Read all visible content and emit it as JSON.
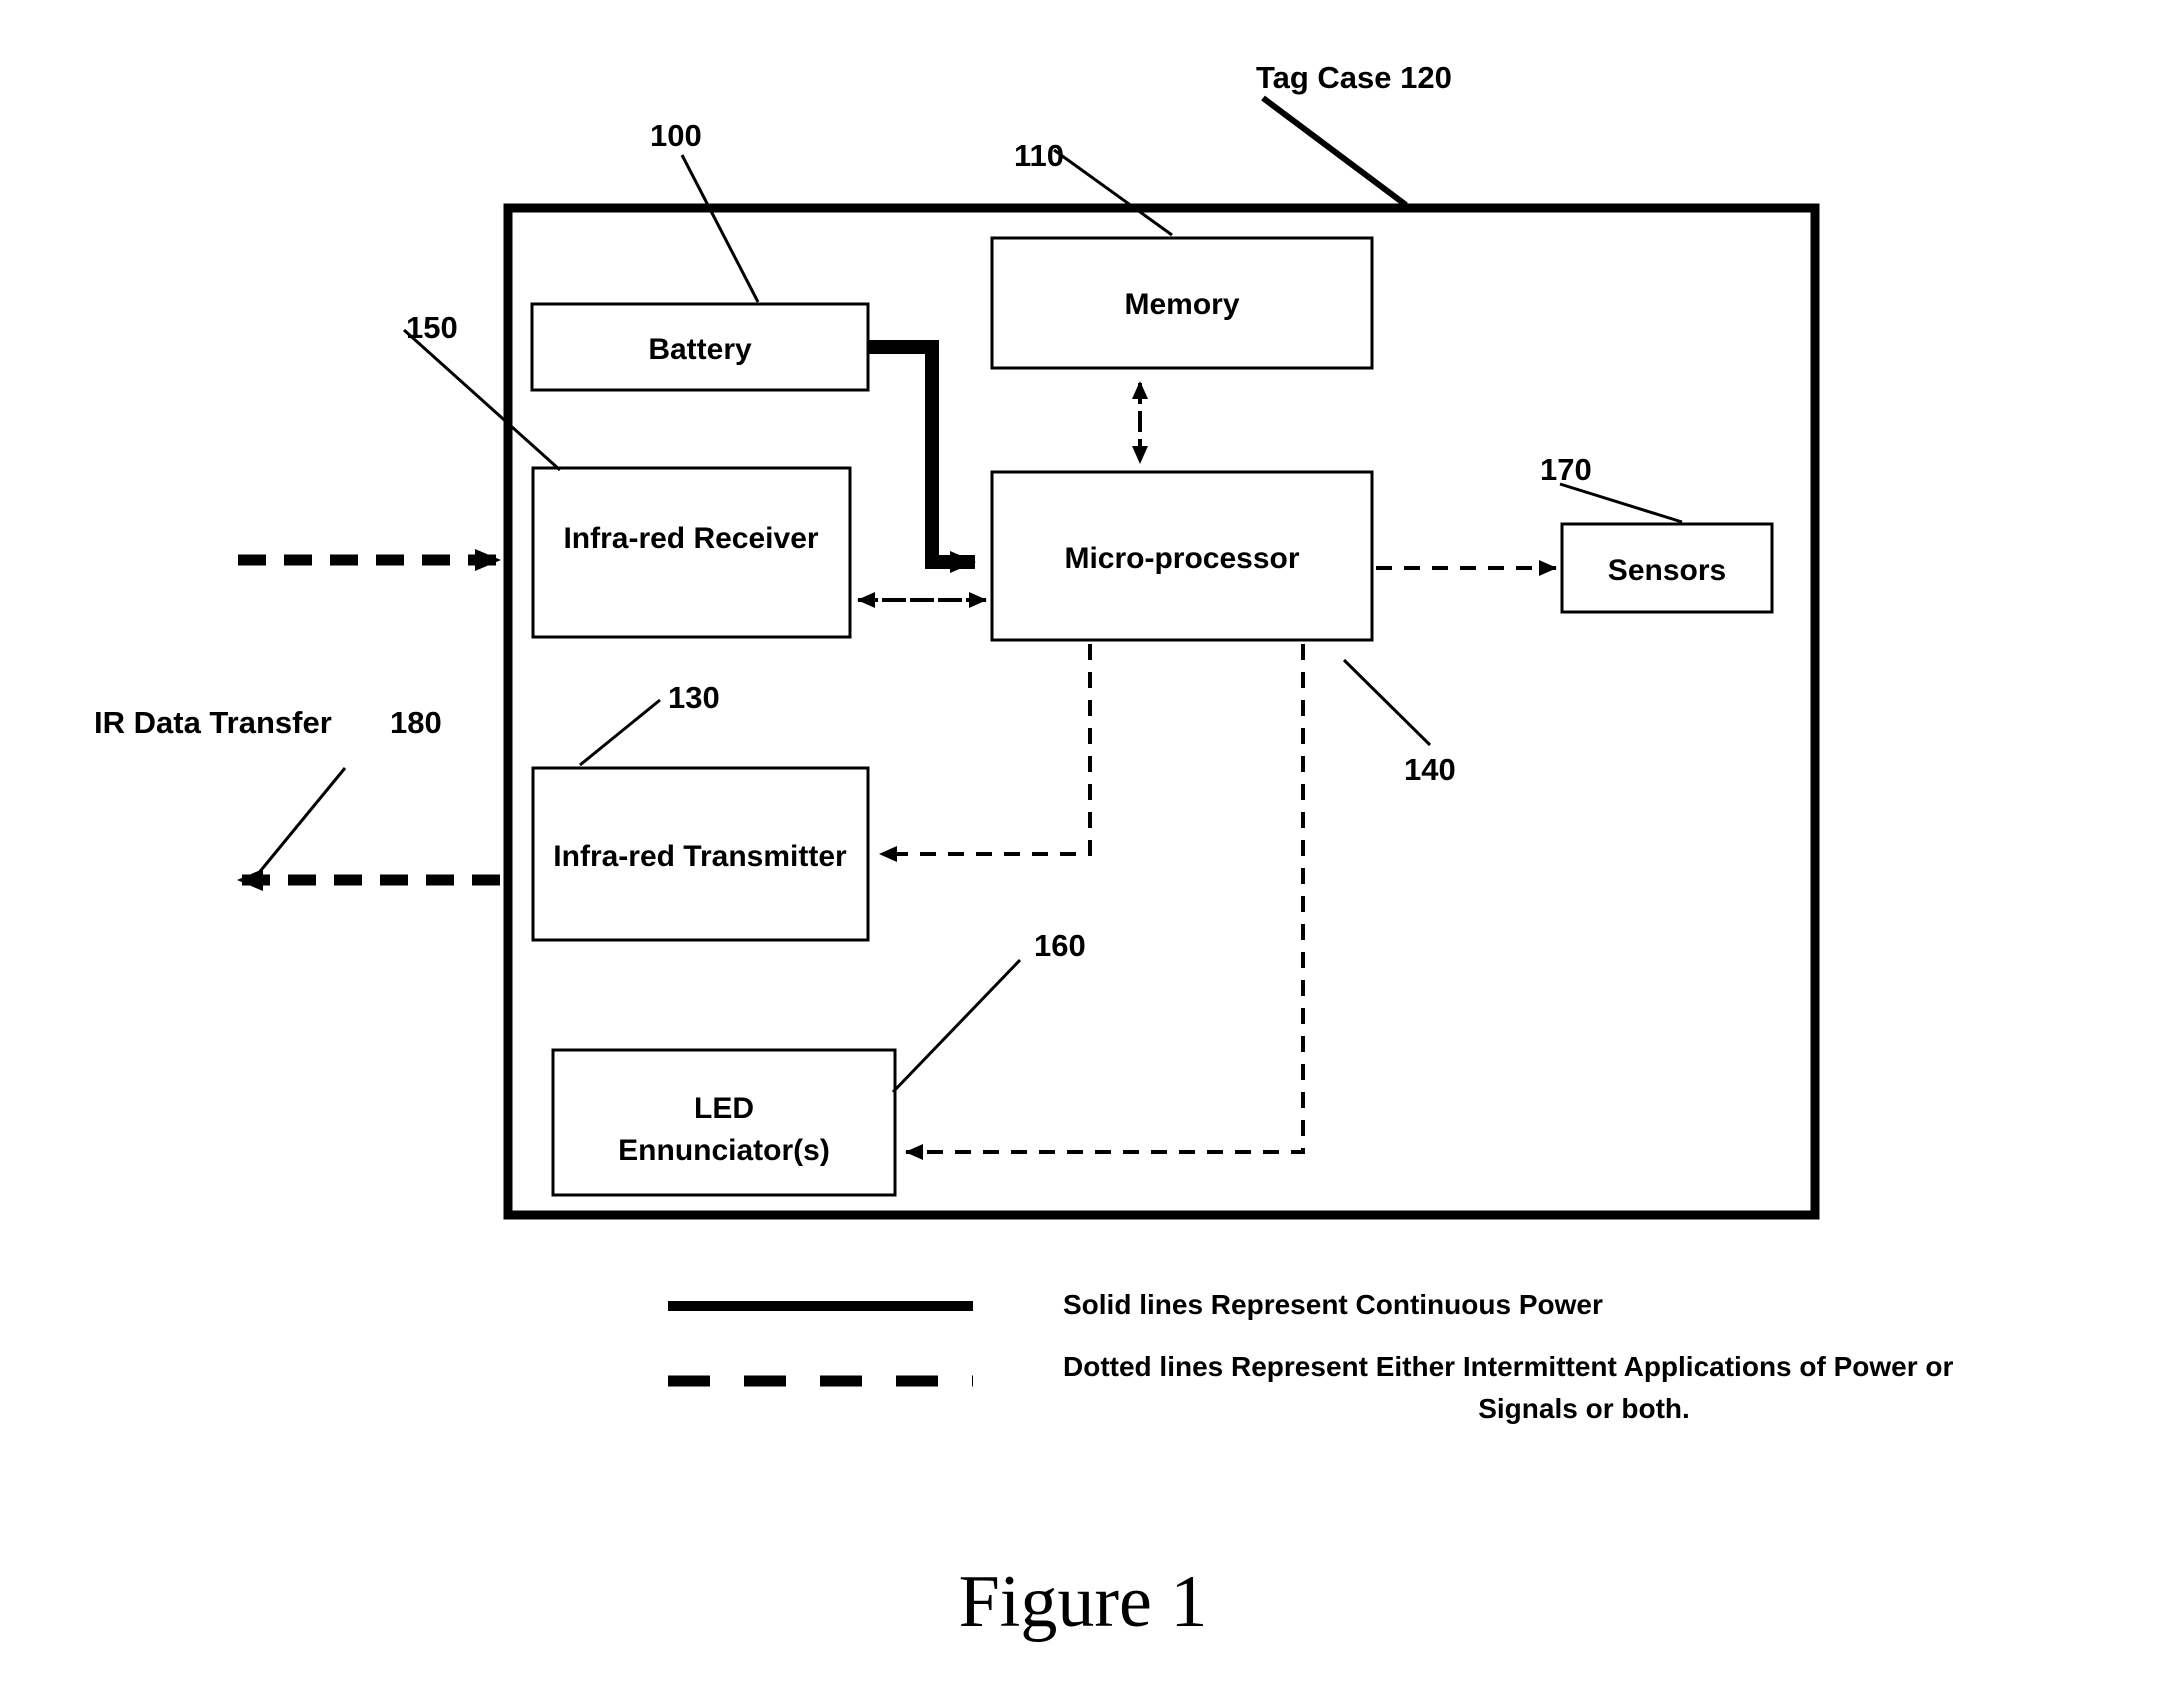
{
  "figure": {
    "caption": "Figure 1",
    "tag_case": {
      "label": "Tag Case 120",
      "ref": "120"
    }
  },
  "blocks": [
    {
      "id": "battery",
      "label": "Battery",
      "ref": "100"
    },
    {
      "id": "memory",
      "label": "Memory",
      "ref": "110"
    },
    {
      "id": "ir_receiver",
      "label": "Infra-red Receiver",
      "ref": "150"
    },
    {
      "id": "microprocessor",
      "label": "Micro-processor",
      "ref": "140"
    },
    {
      "id": "sensors",
      "label": "Sensors",
      "ref": "170"
    },
    {
      "id": "ir_transmitter",
      "label": "Infra-red Transmitter",
      "ref": "130"
    },
    {
      "id": "led_line1",
      "label": "LED",
      "ref": "160"
    },
    {
      "id": "led_line2",
      "label": "Ennunciator(s)",
      "ref": "160"
    }
  ],
  "refs": {
    "battery": "100",
    "memory": "110",
    "tag_case": "120",
    "ir_transmitter": "130",
    "microprocessor": "140",
    "ir_receiver": "150",
    "led_ennunciators": "160",
    "sensors": "170",
    "ir_data_transfer": "180"
  },
  "external": {
    "ir_data_transfer_label": "IR Data Transfer",
    "ir_data_transfer_ref": "180"
  },
  "legend": {
    "solid_text": "Solid lines Represent Continuous Power",
    "dotted_text_line1": "Dotted lines Represent Either Intermittent Applications of Power or",
    "dotted_text_line2": "Signals or both."
  },
  "colors": {
    "ink": "#000000",
    "paper": "#ffffff"
  }
}
